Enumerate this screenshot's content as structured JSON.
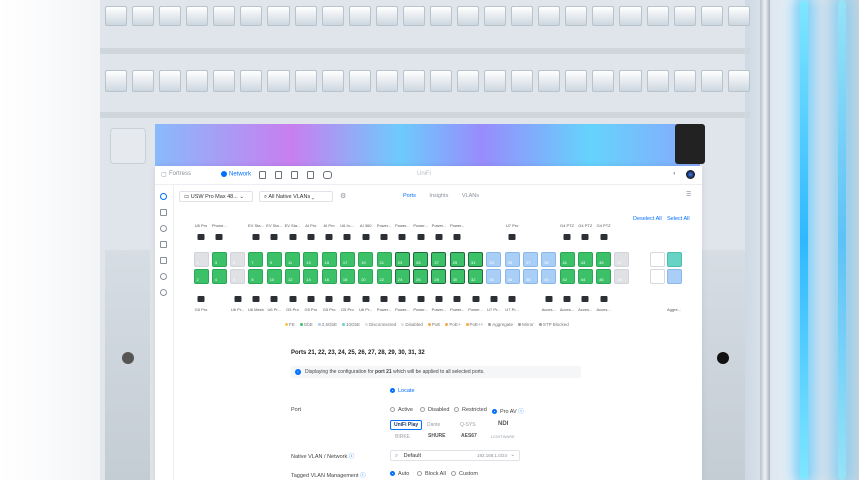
{
  "window": {
    "app_title": "UniFi"
  },
  "topbar": {
    "product_switch": "Fortress",
    "network_label": "Network"
  },
  "toolbar": {
    "device_select": "USW Pro Max 48...",
    "vlan_select": "All Native VLANs",
    "tabs": [
      {
        "label": "Ports",
        "active": true
      },
      {
        "label": "Insights",
        "active": false
      },
      {
        "label": "VLANs",
        "active": false
      }
    ],
    "deselect_all": "Deselect All",
    "select_all": "Select All"
  },
  "top_devices": [
    "U6 Pro",
    "Phone...",
    "",
    "EV Sta...",
    "EV Sta...",
    "EV Sta...",
    "AI Pro",
    "AI Pro",
    "U6 In-...",
    "AI 360",
    "Power...",
    "Power...",
    "Power...",
    "Power...",
    "Power...",
    "",
    "",
    "U7 Pro",
    "",
    "",
    "G4 PTZ",
    "G4 PTZ",
    "G4 PTZ"
  ],
  "bottom_devices": [
    "G5 Pro",
    "",
    "U6 Pr...",
    "U6 Mesh",
    "U6 Pr...",
    "G5 Pro",
    "G5 Pro",
    "G5 Pro",
    "G5 Pro",
    "U6 Pr...",
    "Power...",
    "Power...",
    "Power...",
    "Power...",
    "Power...",
    "Power...",
    "U7 Pr...",
    "U7 Pr...",
    "",
    "Acces...",
    "Acces...",
    "Acces...",
    "Acces..."
  ],
  "sfp_label": "Aggre...",
  "legend": [
    "FE",
    "GbE",
    "2.5GbE",
    "10GbE",
    "Disconnected",
    "Disabled",
    "PoE",
    "PoE+",
    "PoE++",
    "Aggregate",
    "Mirror",
    "STP Blocked"
  ],
  "colors": {
    "accent": "#006fff",
    "gbe": "#3cc168",
    "ge25": "#a9cff6",
    "ge10": "#67d3c4",
    "disconnected": "#dfe1e4"
  },
  "config": {
    "ports_title": "Ports 21, 22, 23, 24, 25, 26, 27, 28, 29, 30, 31, 32",
    "notice_prefix": "Displaying the configuration for ",
    "notice_port": "port 21",
    "notice_suffix": " which will be applied to all selected ports.",
    "locate": "Locate",
    "port_label": "Port",
    "port_options": [
      {
        "label": "Active",
        "on": false
      },
      {
        "label": "Disabled",
        "on": false
      },
      {
        "label": "Restricted",
        "on": false
      },
      {
        "label": "Pro AV",
        "on": true
      }
    ],
    "brands": [
      "UniFi Play",
      "Dante",
      "Q-SYS",
      "NDI",
      "BIRKE",
      "SHURE",
      "AES67",
      "LIGHTWARE"
    ],
    "native_vlan_label": "Native VLAN / Network",
    "native_vlan_value": "Default",
    "native_vlan_subnet": "192.168.1.0/24",
    "tagged_label": "Tagged VLAN Management",
    "tagged_options": [
      {
        "label": "Auto",
        "on": true
      },
      {
        "label": "Block All",
        "on": false
      },
      {
        "label": "Custom",
        "on": false
      }
    ]
  }
}
